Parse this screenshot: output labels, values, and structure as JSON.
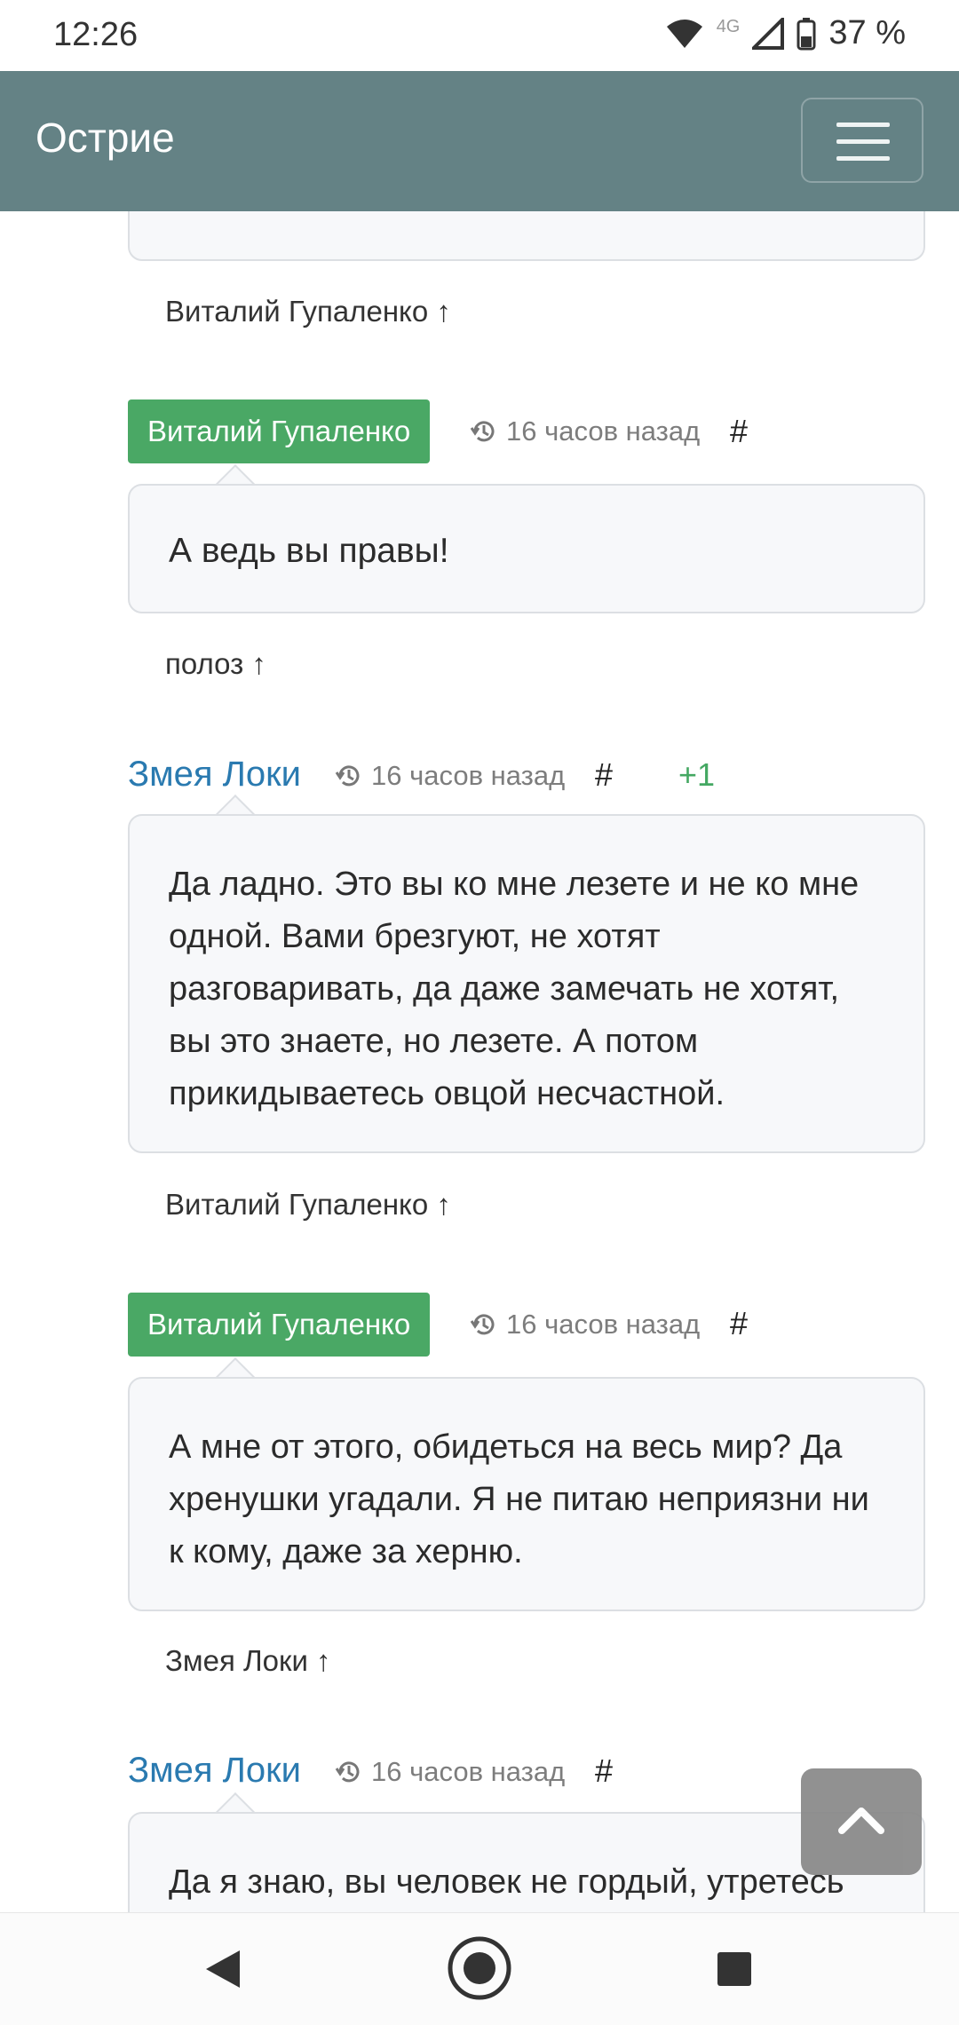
{
  "status": {
    "time": "12:26",
    "network": "4G",
    "battery": "37 %"
  },
  "navbar": {
    "brand": "Острие"
  },
  "comments": [
    {
      "author": "Виталий Гупаленко",
      "time": "16 часов назад",
      "hash": "#",
      "text": "А ведь вы правы!",
      "reply_to": "полоз ↑"
    },
    {
      "author": "Змея Локи",
      "time": "16 часов назад",
      "hash": "#",
      "score": "+1",
      "text": "Да ладно. Это вы ко мне лезете и не ко мне одной. Вами брезгуют, не хотят разговаривать, да даже замечать не хотят, вы это знаете, но лезете. А потом прикидываетесь овцой несчастной.",
      "reply_to": "Виталий Гупаленко ↑"
    },
    {
      "author": "Виталий Гупаленко",
      "time": "16 часов назад",
      "hash": "#",
      "text": "А мне от этого, обидеться на весь мир? Да хренушки угадали. Я не питаю неприязни ни к кому, даже за херню.",
      "reply_to": "Змея Локи ↑"
    },
    {
      "author": "Змея Локи",
      "time": "16 часов назад",
      "hash": "#",
      "text": "Да я знаю, вы человек не гордый, утретесь"
    }
  ],
  "top_reply": "Виталий Гупаленко ↑",
  "icons": {
    "history": "history-icon",
    "menu": "menu-icon",
    "scroll_top": "chevron-up-icon"
  }
}
